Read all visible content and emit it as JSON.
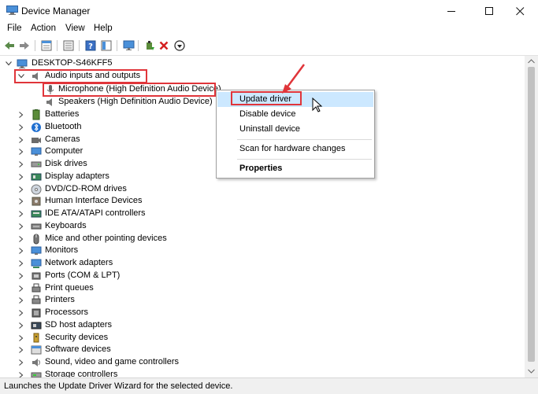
{
  "window": {
    "title": "Device Manager",
    "minimize_icon": "minimize-icon",
    "maximize_icon": "maximize-icon",
    "close_icon": "close-icon"
  },
  "menubar": {
    "items": [
      "File",
      "Action",
      "View",
      "Help"
    ]
  },
  "toolbar": {
    "icons": [
      "back-icon",
      "forward-icon",
      "properties-icon",
      "show-hidden-icon",
      "help-icon",
      "console-icon",
      "monitor-icon",
      "update-driver-icon",
      "uninstall-icon",
      "scan-icon"
    ]
  },
  "tree": {
    "root": "DESKTOP-S46KFF5",
    "expanded": {
      "label": "Audio inputs and outputs",
      "children": [
        "Microphone (High Definition Audio Device)",
        "Speakers (High Definition Audio Device)"
      ]
    },
    "categories": [
      "Batteries",
      "Bluetooth",
      "Cameras",
      "Computer",
      "Disk drives",
      "Display adapters",
      "DVD/CD-ROM drives",
      "Human Interface Devices",
      "IDE ATA/ATAPI controllers",
      "Keyboards",
      "Mice and other pointing devices",
      "Monitors",
      "Network adapters",
      "Ports (COM & LPT)",
      "Print queues",
      "Printers",
      "Processors",
      "SD host adapters",
      "Security devices",
      "Software devices",
      "Sound, video and game controllers",
      "Storage controllers"
    ]
  },
  "context_menu": {
    "items": [
      "Update driver",
      "Disable device",
      "Uninstall device",
      "Scan for hardware changes",
      "Properties"
    ],
    "highlighted": "Update driver"
  },
  "statusbar": {
    "text": "Launches the Update Driver Wizard for the selected device."
  },
  "colors": {
    "highlight_border": "#e0353a",
    "menu_hover": "#cce8ff",
    "accent": "#0078d7"
  }
}
